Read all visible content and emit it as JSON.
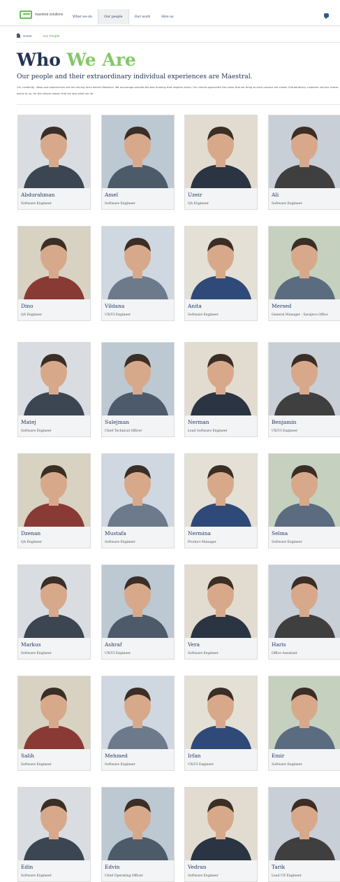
{
  "header": {
    "logo_text": "maestral solutions",
    "nav": [
      {
        "label": "What we do",
        "active": false
      },
      {
        "label": "Our people",
        "active": true
      },
      {
        "label": "Our work",
        "active": false
      },
      {
        "label": "Hire us",
        "active": false
      }
    ]
  },
  "breadcrumb": {
    "home": "Home",
    "current": "Our People"
  },
  "title": {
    "part1": "Who",
    "part2": "We Are"
  },
  "subtitle": "Our people and their extraordinary individual experiences are Maestral.",
  "body": "Our creativity, ideas and experiences are the driving force behind Maestral. We encourage outside-the-box thinking that inspires vision. Our clients appreciate the value that we bring to each product we create. Extraordinary customer service comes easily to us, for the simple reason that we love what we do.",
  "colors": {
    "navy": "#233553",
    "accent": "#85c76a",
    "link": "#1e3a66"
  },
  "people": [
    {
      "name": "Abdurahman",
      "role": "Software Engineer"
    },
    {
      "name": "Amel",
      "role": "Software Engineer"
    },
    {
      "name": "Uzeir",
      "role": "QA Engineer"
    },
    {
      "name": "Ali",
      "role": "Software Engineer"
    },
    {
      "name": "Dino",
      "role": "QA Engineer"
    },
    {
      "name": "Vildana",
      "role": "UX/UI Engineer"
    },
    {
      "name": "Anita",
      "role": "Software Engineer"
    },
    {
      "name": "Mersed",
      "role": "General Manager - Sarajevo Office"
    },
    {
      "name": "Matej",
      "role": "Software Engineer"
    },
    {
      "name": "Sulejman",
      "role": "Chief Technical Officer"
    },
    {
      "name": "Nerman",
      "role": "Lead Software Engineer"
    },
    {
      "name": "Benjamin",
      "role": "UX/UI Engineer"
    },
    {
      "name": "Dzenan",
      "role": "QA Engineer"
    },
    {
      "name": "Mustafa",
      "role": "Software Engineer"
    },
    {
      "name": "Nermina",
      "role": "Product Manager"
    },
    {
      "name": "Selma",
      "role": "Software Engineer"
    },
    {
      "name": "Markus",
      "role": "Software Engineer"
    },
    {
      "name": "Ashraf",
      "role": "UX/UI Engineer"
    },
    {
      "name": "Vera",
      "role": "Software Engineer"
    },
    {
      "name": "Haris",
      "role": "Office Assistant"
    },
    {
      "name": "Salih",
      "role": "Software Engineer"
    },
    {
      "name": "Mehmed",
      "role": "Software Engineer"
    },
    {
      "name": "Irfan",
      "role": "UX/UI Engineer"
    },
    {
      "name": "Emir",
      "role": "Software Engineer"
    },
    {
      "name": "Edin",
      "role": "Software Engineer"
    },
    {
      "name": "Edvin",
      "role": "Chief Operating Officer"
    },
    {
      "name": "Vedran",
      "role": "Software Engineer"
    },
    {
      "name": "Tarik",
      "role": "Lead UX Engineer"
    }
  ]
}
